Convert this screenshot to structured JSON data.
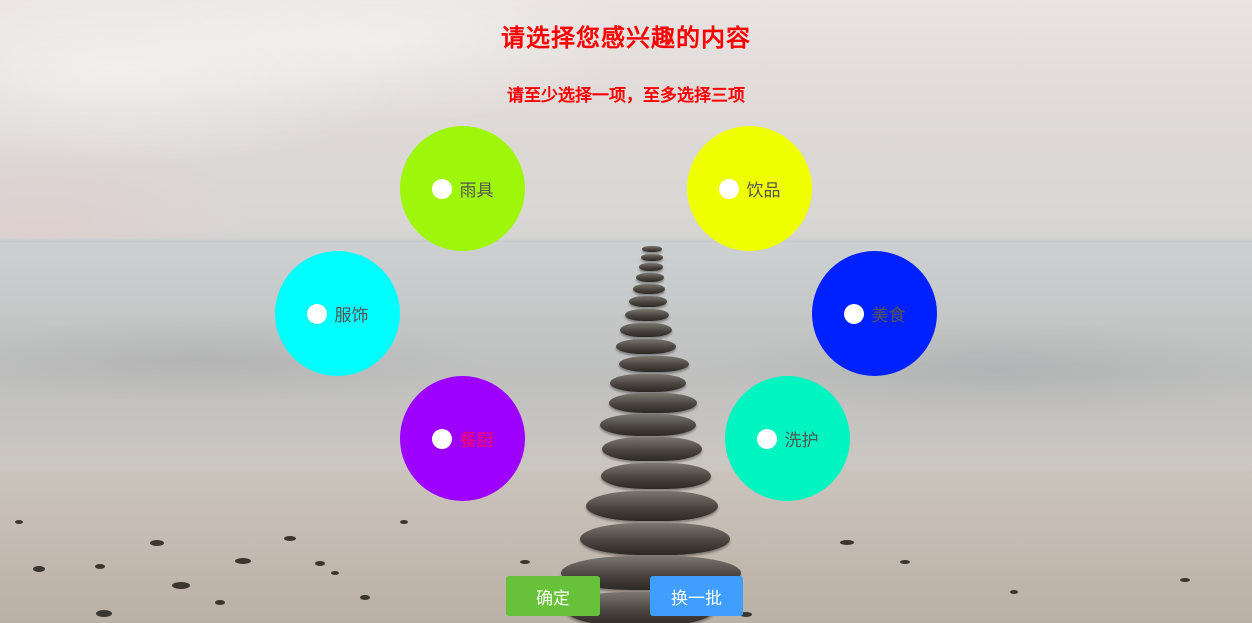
{
  "header": {
    "title": "请选择您感兴趣的内容",
    "subtitle": "请至少选择一项，至多选择三项"
  },
  "options": [
    {
      "label": "雨具",
      "color": "#9ef70a",
      "label_color": "#555555",
      "selected": false
    },
    {
      "label": "饮品",
      "color": "#f0ff00",
      "label_color": "#555555",
      "selected": false
    },
    {
      "label": "服饰",
      "color": "#00ffff",
      "label_color": "#555555",
      "selected": false
    },
    {
      "label": "美食",
      "color": "#0021ff",
      "label_color": "#555555",
      "selected": false
    },
    {
      "label": "餐厨",
      "color": "#9d00ff",
      "label_color": "#ff0066",
      "selected": false
    },
    {
      "label": "洗护",
      "color": "#00f5c0",
      "label_color": "#555555",
      "selected": false
    }
  ],
  "buttons": {
    "confirm_label": "确定",
    "refresh_label": "换一批"
  },
  "colors": {
    "title": "#ff0000",
    "confirm": "#67c23a",
    "refresh": "#409eff"
  }
}
